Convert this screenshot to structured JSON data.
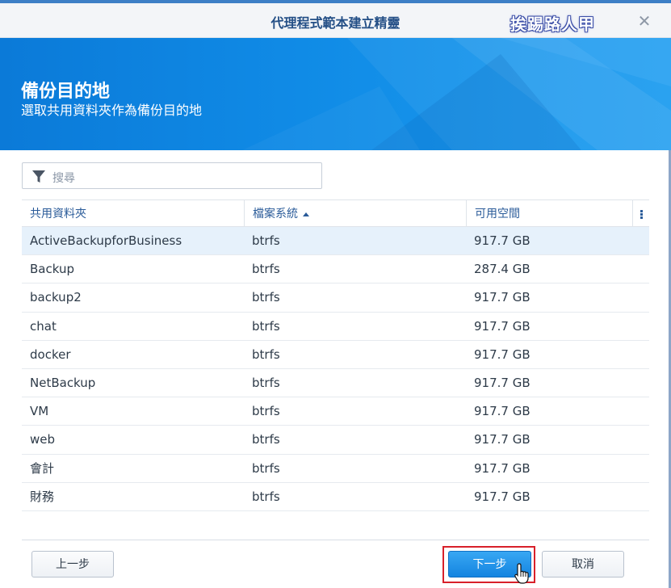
{
  "window": {
    "title": "代理程式範本建立精靈",
    "watermark": "挨踢路人甲",
    "close_symbol": "✕"
  },
  "banner": {
    "heading": "備份目的地",
    "subheading": "選取共用資料夾作為備份目的地"
  },
  "search": {
    "placeholder": "搜尋",
    "icon": "filter-icon"
  },
  "table": {
    "columns": [
      "共用資料夾",
      "檔案系統",
      "可用空間"
    ],
    "sorted_column": "檔案系統",
    "sort_direction": "ascending",
    "rows": [
      {
        "name": "ActiveBackupforBusiness",
        "fs": "btrfs",
        "space": "917.7 GB",
        "selected": true
      },
      {
        "name": "Backup",
        "fs": "btrfs",
        "space": "287.4 GB"
      },
      {
        "name": "backup2",
        "fs": "btrfs",
        "space": "917.7 GB"
      },
      {
        "name": "chat",
        "fs": "btrfs",
        "space": "917.7 GB"
      },
      {
        "name": "docker",
        "fs": "btrfs",
        "space": "917.7 GB"
      },
      {
        "name": "NetBackup",
        "fs": "btrfs",
        "space": "917.7 GB"
      },
      {
        "name": "VM",
        "fs": "btrfs",
        "space": "917.7 GB"
      },
      {
        "name": "web",
        "fs": "btrfs",
        "space": "917.7 GB"
      },
      {
        "name": "會計",
        "fs": "btrfs",
        "space": "917.7 GB"
      },
      {
        "name": "財務",
        "fs": "btrfs",
        "space": "917.7 GB"
      }
    ]
  },
  "footer": {
    "back_label": "上一步",
    "next_label": "下一步",
    "cancel_label": "取消"
  },
  "colors": {
    "accent": "#108be6",
    "header_text": "#2a5b99",
    "selected_row": "#e6f1fb",
    "highlight": "#d8202a"
  }
}
